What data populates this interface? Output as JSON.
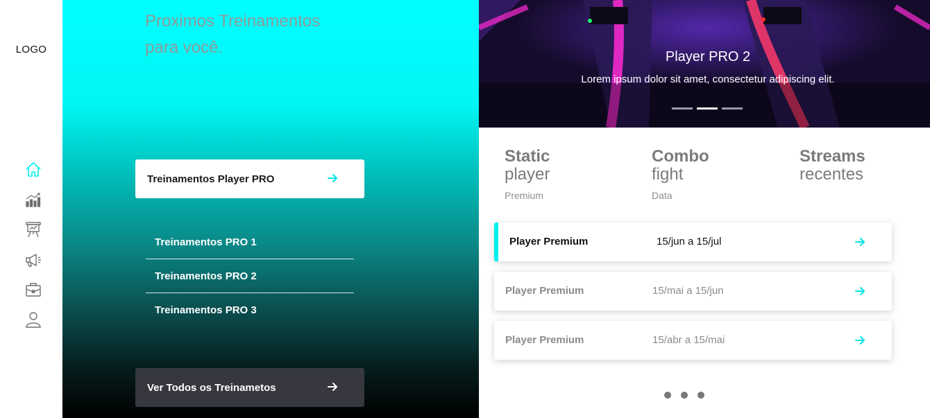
{
  "sidebar": {
    "logo": "LOGO",
    "items": [
      {
        "icon": "home-icon"
      },
      {
        "icon": "chart-icon"
      },
      {
        "icon": "presentation-icon"
      },
      {
        "icon": "megaphone-icon"
      },
      {
        "icon": "briefcase-icon"
      },
      {
        "icon": "user-icon"
      }
    ]
  },
  "trainings": {
    "title": "Proximos Treinamentos para você.",
    "main_card": "Treinamentos Player PRO",
    "sub_items": [
      "Treinamentos PRO 1",
      "Treinamentos PRO 2",
      "Treinamentos PRO 3"
    ],
    "view_all": "Ver Todos os Treinametos"
  },
  "hero": {
    "title": "Player PRO 2",
    "subtitle": "Lorem ipsum dolor sit amet, consectetur adipiscing elit.",
    "slides": 3,
    "active_slide": 2
  },
  "columns": [
    {
      "title_bold": "Static",
      "title_light": "player",
      "caption": "Premium"
    },
    {
      "title_bold": "Combo",
      "title_light": "fight",
      "caption": "Data"
    },
    {
      "title_bold": "Streams",
      "title_light": "recentes",
      "caption": ""
    }
  ],
  "rows": [
    {
      "name": "Player Premium",
      "dates": "15/jun a 15/jul",
      "active": true
    },
    {
      "name": "Player Premium",
      "dates": "15/mai a 15/jun",
      "active": false
    },
    {
      "name": "Player Premium",
      "dates": "15/abr a 15/mai",
      "active": false
    }
  ],
  "pager": {
    "count": 3
  },
  "colors": {
    "accent": "#00f0f0",
    "cyan": "#00ffff",
    "dark_button": "#37383f",
    "text_gray": "#8a8a8a"
  }
}
